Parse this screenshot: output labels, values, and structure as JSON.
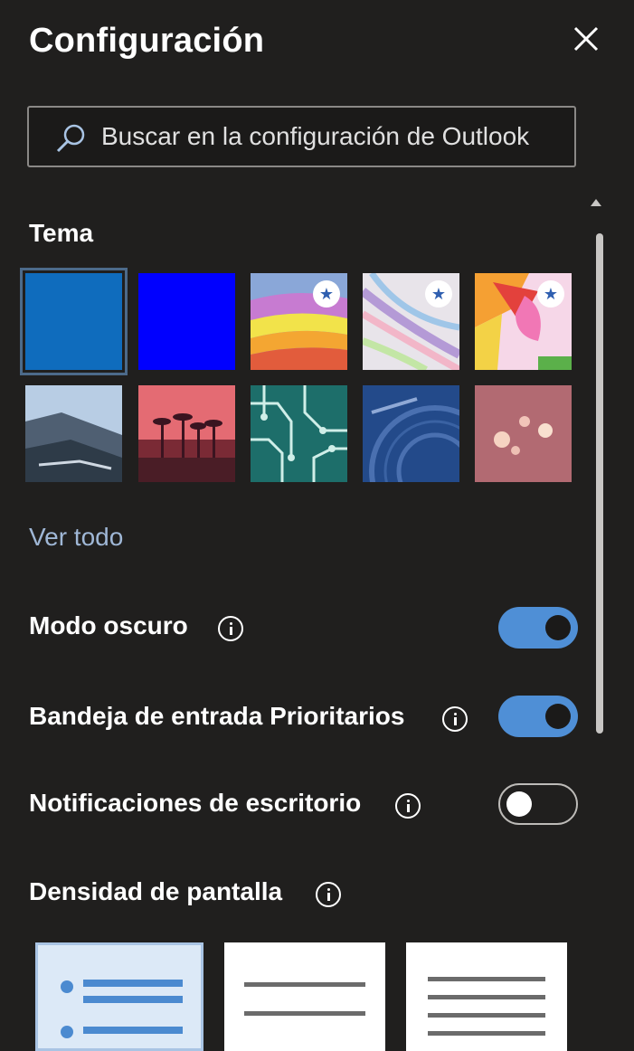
{
  "panel": {
    "title": "Configuración",
    "close_icon": "close-icon"
  },
  "search": {
    "placeholder": "Buscar en la configuración de Outlook",
    "icon": "search-icon"
  },
  "theme": {
    "label": "Tema",
    "selected_index": 0,
    "tiles": [
      {
        "name": "blue",
        "color": "#0f6cbd",
        "premium": false
      },
      {
        "name": "bright-blue",
        "color": "#0000ff",
        "premium": false
      },
      {
        "name": "rainbow",
        "premium": true
      },
      {
        "name": "pastel-lines",
        "premium": true
      },
      {
        "name": "colorful-art",
        "premium": true
      },
      {
        "name": "mountains",
        "premium": false
      },
      {
        "name": "palm-sunset",
        "premium": false
      },
      {
        "name": "circuit",
        "premium": false
      },
      {
        "name": "blue-texture",
        "premium": false
      },
      {
        "name": "bokeh-pink",
        "premium": false
      }
    ],
    "see_all": "Ver todo"
  },
  "settings": {
    "dark_mode": {
      "label": "Modo oscuro",
      "on": true
    },
    "focused_inbox": {
      "label": "Bandeja de entrada Prioritarios",
      "on": true
    },
    "desktop_notifications": {
      "label": "Notificaciones de escritorio",
      "on": false
    }
  },
  "density": {
    "label": "Densidad de pantalla",
    "options": [
      "full",
      "medium",
      "compact"
    ],
    "selected": "full"
  },
  "colors": {
    "background": "#201f1e",
    "accent": "#4f8fd6",
    "link": "#9fb7d6"
  }
}
